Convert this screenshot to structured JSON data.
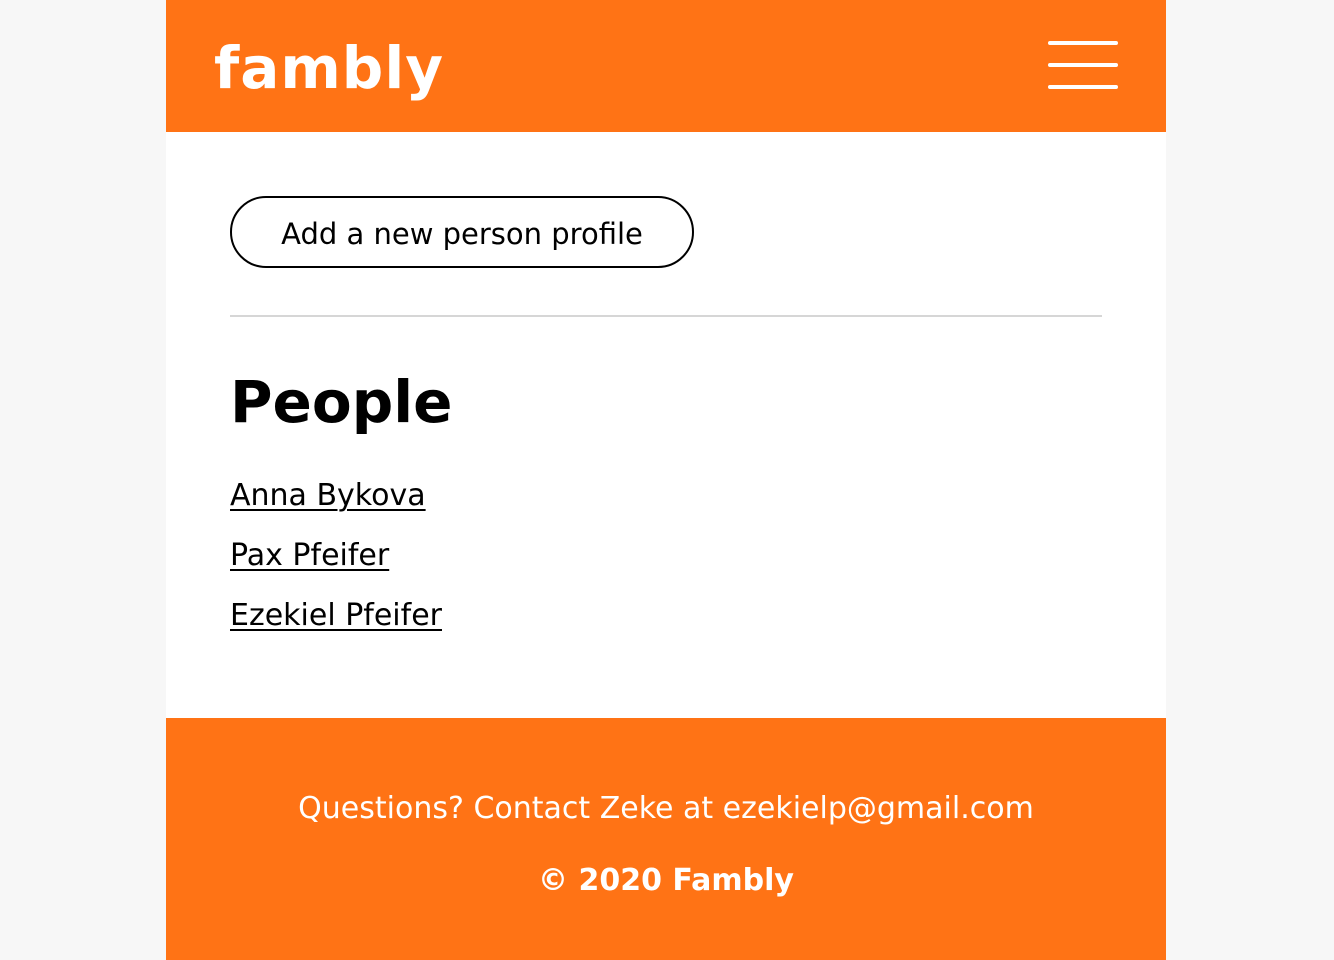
{
  "header": {
    "logo_text": "fambly",
    "menu_icon": "hamburger-menu-icon"
  },
  "main": {
    "add_button_label": "Add a new person profile",
    "section_title": "People",
    "people": [
      {
        "name": "Anna Bykova"
      },
      {
        "name": "Pax Pfeifer"
      },
      {
        "name": "Ezekiel Pfeifer"
      }
    ]
  },
  "footer": {
    "contact_text": "Questions? Contact Zeke at ezekielp@gmail.com",
    "copyright": "© 2020 Fambly"
  },
  "colors": {
    "brand_orange": "#ff7315",
    "page_background": "#f7f7f7",
    "content_background": "#ffffff",
    "text": "#000000",
    "divider": "#d6d6d6"
  }
}
